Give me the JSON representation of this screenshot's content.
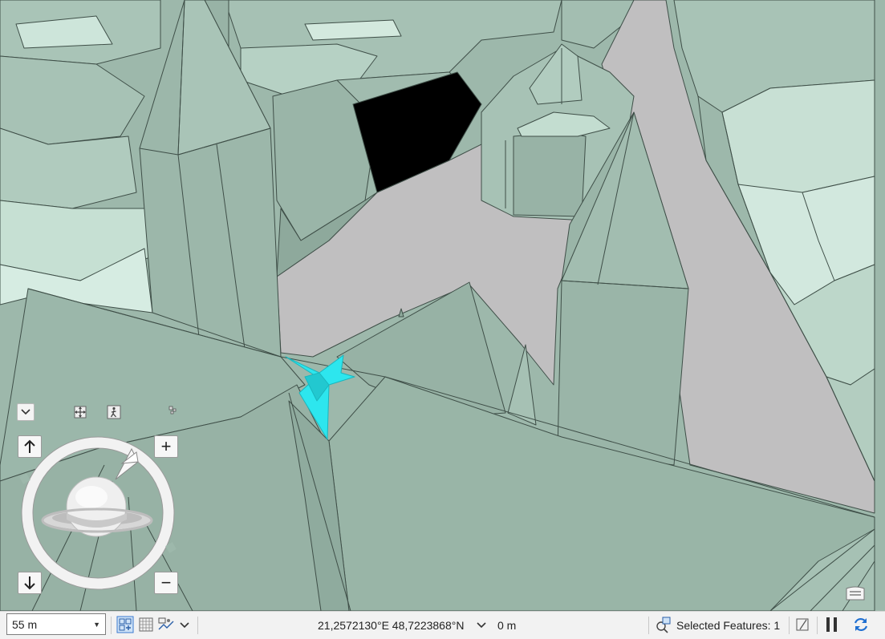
{
  "viewport": {
    "tooltip_hint": "3D scene view",
    "colors": {
      "roof": "#9db8ab",
      "roof_dark": "#8aa99b",
      "roof_light": "#cfe6dc",
      "street": "#c0bfc0",
      "selected": "#2de6ee"
    }
  },
  "navigator": {
    "collapse_icon": "chevron-down-icon",
    "full_control_icon": "pan-arrows-icon",
    "first_person_icon": "walk-person-icon",
    "small_dots_icon": "navigator-mini-icon",
    "up_icon": "arrow-up-icon",
    "down_icon": "arrow-down-icon",
    "zoom_in": "+",
    "zoom_out": "−"
  },
  "statusbar": {
    "scale": "55 m",
    "coordinates": "21,2572130°E 48,7223868°N",
    "elevation": "0 m",
    "selected_features": "Selected Features: 1"
  }
}
